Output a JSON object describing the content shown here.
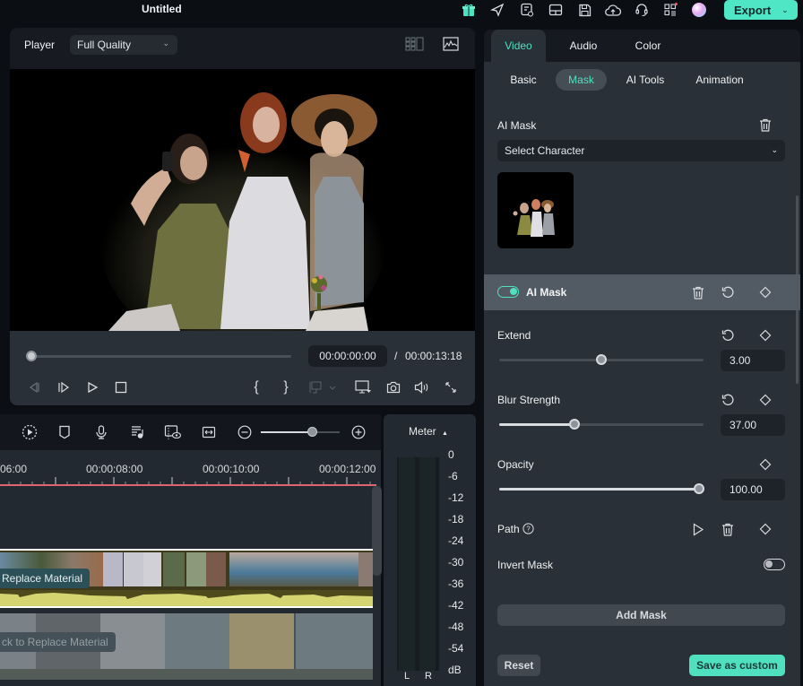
{
  "app": {
    "title": "Untitled",
    "accent_color": "#4fe6c6",
    "export_label": "Export",
    "toolbar_icons": [
      "gift-icon",
      "send-icon",
      "task-list-icon",
      "layout-icon",
      "save-icon",
      "cloud-upload-icon",
      "headset-icon",
      "apps-grid-icon",
      "avatar"
    ]
  },
  "player": {
    "label": "Player",
    "quality": "Full Quality",
    "timecode_current": "00:00:00:00",
    "timecode_separator": "/",
    "timecode_total": "00:00:13:18",
    "playback_progress": 0
  },
  "timeline": {
    "ruler_labels": [
      "06:00",
      "00:00:08:00",
      "00:00:10:00",
      "00:00:12:00"
    ],
    "zoom_level": 0.66,
    "replace_material_label": "Replace Material",
    "click_to_replace_label": "ck to Replace Material"
  },
  "meter": {
    "title": "Meter",
    "title_arrow": "▲",
    "scale": [
      "0",
      "-6",
      "-12",
      "-18",
      "-24",
      "-30",
      "-36",
      "-42",
      "-48",
      "-54",
      "dB"
    ],
    "channels": [
      "L",
      "R"
    ]
  },
  "properties": {
    "main_tabs": [
      {
        "label": "Video",
        "active": true
      },
      {
        "label": "Audio",
        "active": false
      },
      {
        "label": "Color",
        "active": false
      }
    ],
    "sub_tabs": [
      {
        "label": "Basic",
        "active": false
      },
      {
        "label": "Mask",
        "active": true
      },
      {
        "label": "AI Tools",
        "active": false
      },
      {
        "label": "Animation",
        "active": false
      }
    ],
    "ai_mask_section_title": "AI Mask",
    "character_select": "Select Character",
    "ai_mask_item": {
      "label": "AI Mask",
      "enabled": true
    },
    "extend": {
      "label": "Extend",
      "value": "3.00",
      "fraction": 0.5
    },
    "blur_strength": {
      "label": "Blur Strength",
      "value": "37.00",
      "fraction": 0.37
    },
    "opacity": {
      "label": "Opacity",
      "value": "100.00",
      "fraction": 1.0
    },
    "path": {
      "label": "Path"
    },
    "invert_mask": {
      "label": "Invert Mask",
      "enabled": false
    },
    "add_mask_label": "Add Mask",
    "reset_label": "Reset",
    "save_custom_label": "Save as custom"
  }
}
